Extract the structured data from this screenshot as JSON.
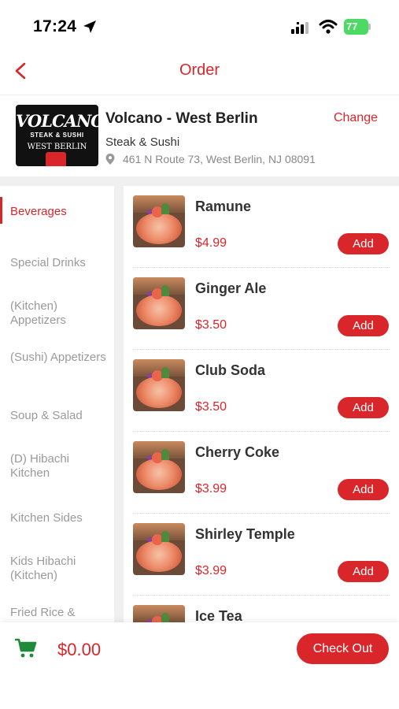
{
  "status_bar": {
    "time": "17:24",
    "battery": "77"
  },
  "nav": {
    "title": "Order"
  },
  "restaurant": {
    "logo_main": "VOLCANO",
    "logo_sub": "STEAK & SUSHI",
    "logo_location": "WEST BERLIN",
    "name": "Volcano - West Berlin",
    "change_label": "Change",
    "category": "Steak & Sushi",
    "address": "461 N Route 73, West Berlin, NJ 08091"
  },
  "categories": [
    {
      "label": "Beverages",
      "active": true
    },
    {
      "label": "Special Drinks"
    },
    {
      "label": "(Kitchen) Appetizers"
    },
    {
      "label": "(Sushi) Appetizers"
    },
    {
      "label": "Soup & Salad"
    },
    {
      "label": "(D) Hibachi Kitchen"
    },
    {
      "label": "Kitchen Sides"
    },
    {
      "label": "Kids Hibachi (Kitchen)"
    },
    {
      "label": "Fried Rice &"
    }
  ],
  "menu_items": [
    {
      "name": "Ramune",
      "price": "$4.99",
      "button": "Add"
    },
    {
      "name": "Ginger Ale",
      "price": "$3.50",
      "button": "Add"
    },
    {
      "name": "Club Soda",
      "price": "$3.50",
      "button": "Add"
    },
    {
      "name": "Cherry Coke",
      "price": "$3.99",
      "button": "Add"
    },
    {
      "name": "Shirley Temple",
      "price": "$3.99",
      "button": "Add"
    },
    {
      "name": "Ice Tea",
      "price": "",
      "button": ""
    }
  ],
  "cart": {
    "total": "$0.00",
    "checkout_label": "Check Out"
  },
  "colors": {
    "accent": "#d9262b",
    "cart_icon": "#1e8a3a",
    "battery": "#4cd964"
  }
}
